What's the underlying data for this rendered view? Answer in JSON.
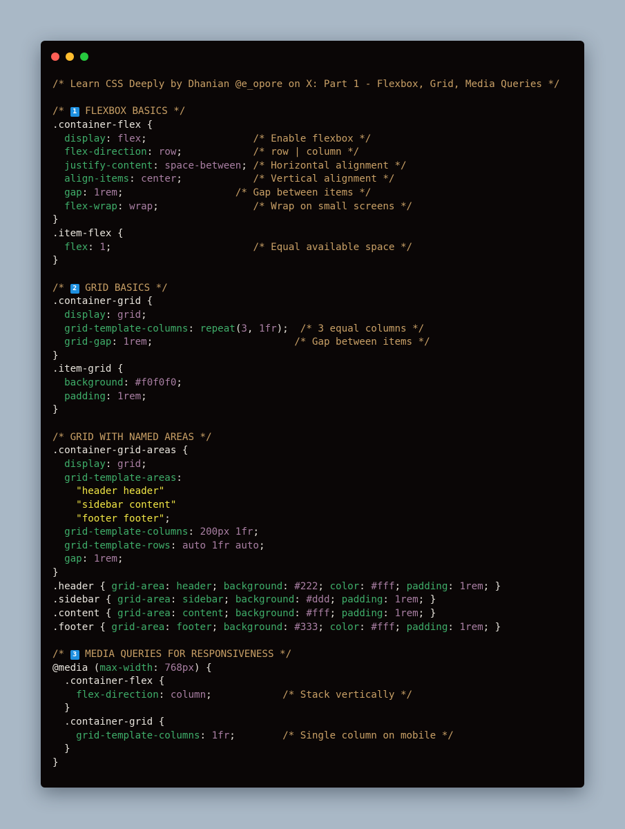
{
  "window": {
    "controls": [
      {
        "name": "close",
        "color": "#ff5f56"
      },
      {
        "name": "minimize",
        "color": "#ffbd2e"
      },
      {
        "name": "maximize",
        "color": "#27c93f"
      }
    ]
  },
  "code": {
    "lines": [
      [
        {
          "t": "comment",
          "v": "/* Learn CSS Deeply by Dhanian @e_opore on X: Part 1 - Flexbox, Grid, Media Queries */"
        }
      ],
      [],
      [
        {
          "t": "comment",
          "v": "/* "
        },
        {
          "t": "badge",
          "v": "1"
        },
        {
          "t": "comment",
          "v": " FLEXBOX BASICS */"
        }
      ],
      [
        {
          "t": "sel",
          "v": ".container-flex {"
        }
      ],
      [
        {
          "t": "punct",
          "v": "  "
        },
        {
          "t": "prop",
          "v": "display"
        },
        {
          "t": "punct",
          "v": ": "
        },
        {
          "t": "val",
          "v": "flex"
        },
        {
          "t": "punct",
          "v": ";                  "
        },
        {
          "t": "comment",
          "v": "/* Enable flexbox */"
        }
      ],
      [
        {
          "t": "punct",
          "v": "  "
        },
        {
          "t": "prop",
          "v": "flex-direction"
        },
        {
          "t": "punct",
          "v": ": "
        },
        {
          "t": "val",
          "v": "row"
        },
        {
          "t": "punct",
          "v": ";            "
        },
        {
          "t": "comment",
          "v": "/* row | column */"
        }
      ],
      [
        {
          "t": "punct",
          "v": "  "
        },
        {
          "t": "prop",
          "v": "justify-content"
        },
        {
          "t": "punct",
          "v": ": "
        },
        {
          "t": "val",
          "v": "space-between"
        },
        {
          "t": "punct",
          "v": "; "
        },
        {
          "t": "comment",
          "v": "/* Horizontal alignment */"
        }
      ],
      [
        {
          "t": "punct",
          "v": "  "
        },
        {
          "t": "prop",
          "v": "align-items"
        },
        {
          "t": "punct",
          "v": ": "
        },
        {
          "t": "val",
          "v": "center"
        },
        {
          "t": "punct",
          "v": ";            "
        },
        {
          "t": "comment",
          "v": "/* Vertical alignment */"
        }
      ],
      [
        {
          "t": "punct",
          "v": "  "
        },
        {
          "t": "prop",
          "v": "gap"
        },
        {
          "t": "punct",
          "v": ": "
        },
        {
          "t": "val",
          "v": "1rem"
        },
        {
          "t": "punct",
          "v": ";                   "
        },
        {
          "t": "comment",
          "v": "/* Gap between items */"
        }
      ],
      [
        {
          "t": "punct",
          "v": "  "
        },
        {
          "t": "prop",
          "v": "flex-wrap"
        },
        {
          "t": "punct",
          "v": ": "
        },
        {
          "t": "val",
          "v": "wrap"
        },
        {
          "t": "punct",
          "v": ";                "
        },
        {
          "t": "comment",
          "v": "/* Wrap on small screens */"
        }
      ],
      [
        {
          "t": "sel",
          "v": "}"
        }
      ],
      [
        {
          "t": "sel",
          "v": ".item-flex {"
        }
      ],
      [
        {
          "t": "punct",
          "v": "  "
        },
        {
          "t": "prop",
          "v": "flex"
        },
        {
          "t": "punct",
          "v": ": "
        },
        {
          "t": "val",
          "v": "1"
        },
        {
          "t": "punct",
          "v": ";                        "
        },
        {
          "t": "comment",
          "v": "/* Equal available space */"
        }
      ],
      [
        {
          "t": "sel",
          "v": "}"
        }
      ],
      [],
      [
        {
          "t": "comment",
          "v": "/* "
        },
        {
          "t": "badge",
          "v": "2"
        },
        {
          "t": "comment",
          "v": " GRID BASICS */"
        }
      ],
      [
        {
          "t": "sel",
          "v": ".container-grid {"
        }
      ],
      [
        {
          "t": "punct",
          "v": "  "
        },
        {
          "t": "prop",
          "v": "display"
        },
        {
          "t": "punct",
          "v": ": "
        },
        {
          "t": "val",
          "v": "grid"
        },
        {
          "t": "punct",
          "v": ";"
        }
      ],
      [
        {
          "t": "punct",
          "v": "  "
        },
        {
          "t": "prop",
          "v": "grid-template-columns"
        },
        {
          "t": "punct",
          "v": ": "
        },
        {
          "t": "prop",
          "v": "repeat"
        },
        {
          "t": "punct",
          "v": "("
        },
        {
          "t": "val",
          "v": "3"
        },
        {
          "t": "punct",
          "v": ", "
        },
        {
          "t": "val",
          "v": "1fr"
        },
        {
          "t": "punct",
          "v": ");  "
        },
        {
          "t": "comment",
          "v": "/* 3 equal columns */"
        }
      ],
      [
        {
          "t": "punct",
          "v": "  "
        },
        {
          "t": "prop",
          "v": "grid-gap"
        },
        {
          "t": "punct",
          "v": ": "
        },
        {
          "t": "val",
          "v": "1rem"
        },
        {
          "t": "punct",
          "v": ";                        "
        },
        {
          "t": "comment",
          "v": "/* Gap between items */"
        }
      ],
      [
        {
          "t": "sel",
          "v": "}"
        }
      ],
      [
        {
          "t": "sel",
          "v": ".item-grid {"
        }
      ],
      [
        {
          "t": "punct",
          "v": "  "
        },
        {
          "t": "prop",
          "v": "background"
        },
        {
          "t": "punct",
          "v": ": "
        },
        {
          "t": "val",
          "v": "#f0f0f0"
        },
        {
          "t": "punct",
          "v": ";"
        }
      ],
      [
        {
          "t": "punct",
          "v": "  "
        },
        {
          "t": "prop",
          "v": "padding"
        },
        {
          "t": "punct",
          "v": ": "
        },
        {
          "t": "val",
          "v": "1rem"
        },
        {
          "t": "punct",
          "v": ";"
        }
      ],
      [
        {
          "t": "sel",
          "v": "}"
        }
      ],
      [],
      [
        {
          "t": "comment",
          "v": "/* GRID WITH NAMED AREAS */"
        }
      ],
      [
        {
          "t": "sel",
          "v": ".container-grid-areas {"
        }
      ],
      [
        {
          "t": "punct",
          "v": "  "
        },
        {
          "t": "prop",
          "v": "display"
        },
        {
          "t": "punct",
          "v": ": "
        },
        {
          "t": "val",
          "v": "grid"
        },
        {
          "t": "punct",
          "v": ";"
        }
      ],
      [
        {
          "t": "punct",
          "v": "  "
        },
        {
          "t": "prop",
          "v": "grid-template-areas"
        },
        {
          "t": "punct",
          "v": ":"
        }
      ],
      [
        {
          "t": "punct",
          "v": "    "
        },
        {
          "t": "str",
          "v": "\"header header\""
        }
      ],
      [
        {
          "t": "punct",
          "v": "    "
        },
        {
          "t": "str",
          "v": "\"sidebar content\""
        }
      ],
      [
        {
          "t": "punct",
          "v": "    "
        },
        {
          "t": "str",
          "v": "\"footer footer\""
        },
        {
          "t": "punct",
          "v": ";"
        }
      ],
      [
        {
          "t": "punct",
          "v": "  "
        },
        {
          "t": "prop",
          "v": "grid-template-columns"
        },
        {
          "t": "punct",
          "v": ": "
        },
        {
          "t": "val",
          "v": "200px 1fr"
        },
        {
          "t": "punct",
          "v": ";"
        }
      ],
      [
        {
          "t": "punct",
          "v": "  "
        },
        {
          "t": "prop",
          "v": "grid-template-rows"
        },
        {
          "t": "punct",
          "v": ": "
        },
        {
          "t": "val",
          "v": "auto 1fr auto"
        },
        {
          "t": "punct",
          "v": ";"
        }
      ],
      [
        {
          "t": "punct",
          "v": "  "
        },
        {
          "t": "prop",
          "v": "gap"
        },
        {
          "t": "punct",
          "v": ": "
        },
        {
          "t": "val",
          "v": "1rem"
        },
        {
          "t": "punct",
          "v": ";"
        }
      ],
      [
        {
          "t": "sel",
          "v": "}"
        }
      ],
      [
        {
          "t": "sel",
          "v": ".header { "
        },
        {
          "t": "prop",
          "v": "grid-area"
        },
        {
          "t": "punct",
          "v": ": "
        },
        {
          "t": "prop",
          "v": "header"
        },
        {
          "t": "punct",
          "v": "; "
        },
        {
          "t": "prop",
          "v": "background"
        },
        {
          "t": "punct",
          "v": ": "
        },
        {
          "t": "val",
          "v": "#222"
        },
        {
          "t": "punct",
          "v": "; "
        },
        {
          "t": "prop",
          "v": "color"
        },
        {
          "t": "punct",
          "v": ": "
        },
        {
          "t": "val",
          "v": "#fff"
        },
        {
          "t": "punct",
          "v": "; "
        },
        {
          "t": "prop",
          "v": "padding"
        },
        {
          "t": "punct",
          "v": ": "
        },
        {
          "t": "val",
          "v": "1rem"
        },
        {
          "t": "punct",
          "v": "; }"
        }
      ],
      [
        {
          "t": "sel",
          "v": ".sidebar { "
        },
        {
          "t": "prop",
          "v": "grid-area"
        },
        {
          "t": "punct",
          "v": ": "
        },
        {
          "t": "prop",
          "v": "sidebar"
        },
        {
          "t": "punct",
          "v": "; "
        },
        {
          "t": "prop",
          "v": "background"
        },
        {
          "t": "punct",
          "v": ": "
        },
        {
          "t": "val",
          "v": "#ddd"
        },
        {
          "t": "punct",
          "v": "; "
        },
        {
          "t": "prop",
          "v": "padding"
        },
        {
          "t": "punct",
          "v": ": "
        },
        {
          "t": "val",
          "v": "1rem"
        },
        {
          "t": "punct",
          "v": "; }"
        }
      ],
      [
        {
          "t": "sel",
          "v": ".content { "
        },
        {
          "t": "prop",
          "v": "grid-area"
        },
        {
          "t": "punct",
          "v": ": "
        },
        {
          "t": "prop",
          "v": "content"
        },
        {
          "t": "punct",
          "v": "; "
        },
        {
          "t": "prop",
          "v": "background"
        },
        {
          "t": "punct",
          "v": ": "
        },
        {
          "t": "val",
          "v": "#fff"
        },
        {
          "t": "punct",
          "v": "; "
        },
        {
          "t": "prop",
          "v": "padding"
        },
        {
          "t": "punct",
          "v": ": "
        },
        {
          "t": "val",
          "v": "1rem"
        },
        {
          "t": "punct",
          "v": "; }"
        }
      ],
      [
        {
          "t": "sel",
          "v": ".footer { "
        },
        {
          "t": "prop",
          "v": "grid-area"
        },
        {
          "t": "punct",
          "v": ": "
        },
        {
          "t": "prop",
          "v": "footer"
        },
        {
          "t": "punct",
          "v": "; "
        },
        {
          "t": "prop",
          "v": "background"
        },
        {
          "t": "punct",
          "v": ": "
        },
        {
          "t": "val",
          "v": "#333"
        },
        {
          "t": "punct",
          "v": "; "
        },
        {
          "t": "prop",
          "v": "color"
        },
        {
          "t": "punct",
          "v": ": "
        },
        {
          "t": "val",
          "v": "#fff"
        },
        {
          "t": "punct",
          "v": "; "
        },
        {
          "t": "prop",
          "v": "padding"
        },
        {
          "t": "punct",
          "v": ": "
        },
        {
          "t": "val",
          "v": "1rem"
        },
        {
          "t": "punct",
          "v": "; }"
        }
      ],
      [],
      [
        {
          "t": "comment",
          "v": "/* "
        },
        {
          "t": "badge",
          "v": "3"
        },
        {
          "t": "comment",
          "v": " MEDIA QUERIES FOR RESPONSIVENESS */"
        }
      ],
      [
        {
          "t": "at",
          "v": "@media"
        },
        {
          "t": "punct",
          "v": " ("
        },
        {
          "t": "prop",
          "v": "max-width"
        },
        {
          "t": "punct",
          "v": ": "
        },
        {
          "t": "val",
          "v": "768px"
        },
        {
          "t": "punct",
          "v": ") {"
        }
      ],
      [
        {
          "t": "sel",
          "v": "  .container-flex {"
        }
      ],
      [
        {
          "t": "punct",
          "v": "    "
        },
        {
          "t": "prop",
          "v": "flex-direction"
        },
        {
          "t": "punct",
          "v": ": "
        },
        {
          "t": "val",
          "v": "column"
        },
        {
          "t": "punct",
          "v": ";            "
        },
        {
          "t": "comment",
          "v": "/* Stack vertically */"
        }
      ],
      [
        {
          "t": "sel",
          "v": "  }"
        }
      ],
      [
        {
          "t": "sel",
          "v": "  .container-grid {"
        }
      ],
      [
        {
          "t": "punct",
          "v": "    "
        },
        {
          "t": "prop",
          "v": "grid-template-columns"
        },
        {
          "t": "punct",
          "v": ": "
        },
        {
          "t": "val",
          "v": "1fr"
        },
        {
          "t": "punct",
          "v": ";        "
        },
        {
          "t": "comment",
          "v": "/* Single column on mobile */"
        }
      ],
      [
        {
          "t": "sel",
          "v": "  }"
        }
      ],
      [
        {
          "t": "sel",
          "v": "}"
        }
      ]
    ]
  },
  "colors": {
    "background": "#a9b8c6",
    "window": "#0a0606",
    "comment": "#c9a066",
    "property": "#3fae6a",
    "value": "#a97fa3",
    "string": "#f0e545",
    "text": "#e8e4dc",
    "badge": "#1e90e0"
  }
}
